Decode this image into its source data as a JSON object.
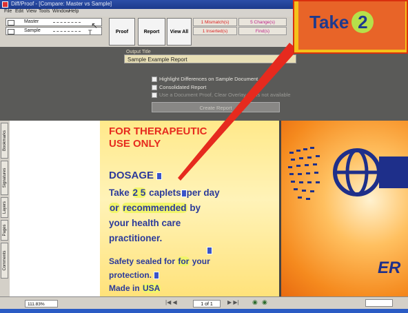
{
  "window": {
    "title": "Diff/Proof - [Compare: Master vs Sample]"
  },
  "menu": {
    "items": [
      "File",
      "Edit",
      "View",
      "Tools",
      "Window",
      "Help"
    ]
  },
  "toolbar": {
    "master_label": "Master",
    "sample_label": "Sample",
    "proof_label": "Proof",
    "report_label": "Report",
    "view_all_label": "View All",
    "status_mismatch": "1 Mismatch(s)",
    "status_inserted": "1 Inserted(s)",
    "status_changes": "5 Change(s)",
    "status_found": "Find(s)"
  },
  "report": {
    "output_title_label": "Output Title",
    "output_title_value": "Sample Example Report",
    "option_highlight": "Highlight Differences on Sample Document",
    "option_consolidated": "Consolidated Report",
    "option_use_document": "Use a Document Proof, Clear Overlay Items not available",
    "create_button": "Create Report"
  },
  "sidetabs": [
    "Bookmarks",
    "Signatures",
    "Layers",
    "Pages",
    "Comments"
  ],
  "document": {
    "heading_line1": "FOR THERAPEUTIC",
    "heading_line2": "USE ONLY",
    "dosage": "DOSAGE",
    "line_take": "Take",
    "line_num": "2 5",
    "line_caplets": "caplets",
    "line_perday": "per day",
    "line_or": "or",
    "line_recommended": "recommended",
    "line_by": "by",
    "line_health": "your health care",
    "line_pract": "practitioner.",
    "line_safety": "Safety sealed for",
    "line_for": "for",
    "line_your": "your",
    "line_protection": "protection.",
    "line_made": "Made in",
    "line_usa": "USA",
    "page2_text": "ER"
  },
  "callout": {
    "text": "Take",
    "number": "2"
  },
  "statusbar": {
    "page": "1 of 1",
    "zoom": "111.83%"
  },
  "colors": {
    "accent_red": "#e62a1e",
    "text_blue": "#2b3a9a",
    "highlight": "#f1f56a",
    "callout_bg": "#e86428"
  }
}
